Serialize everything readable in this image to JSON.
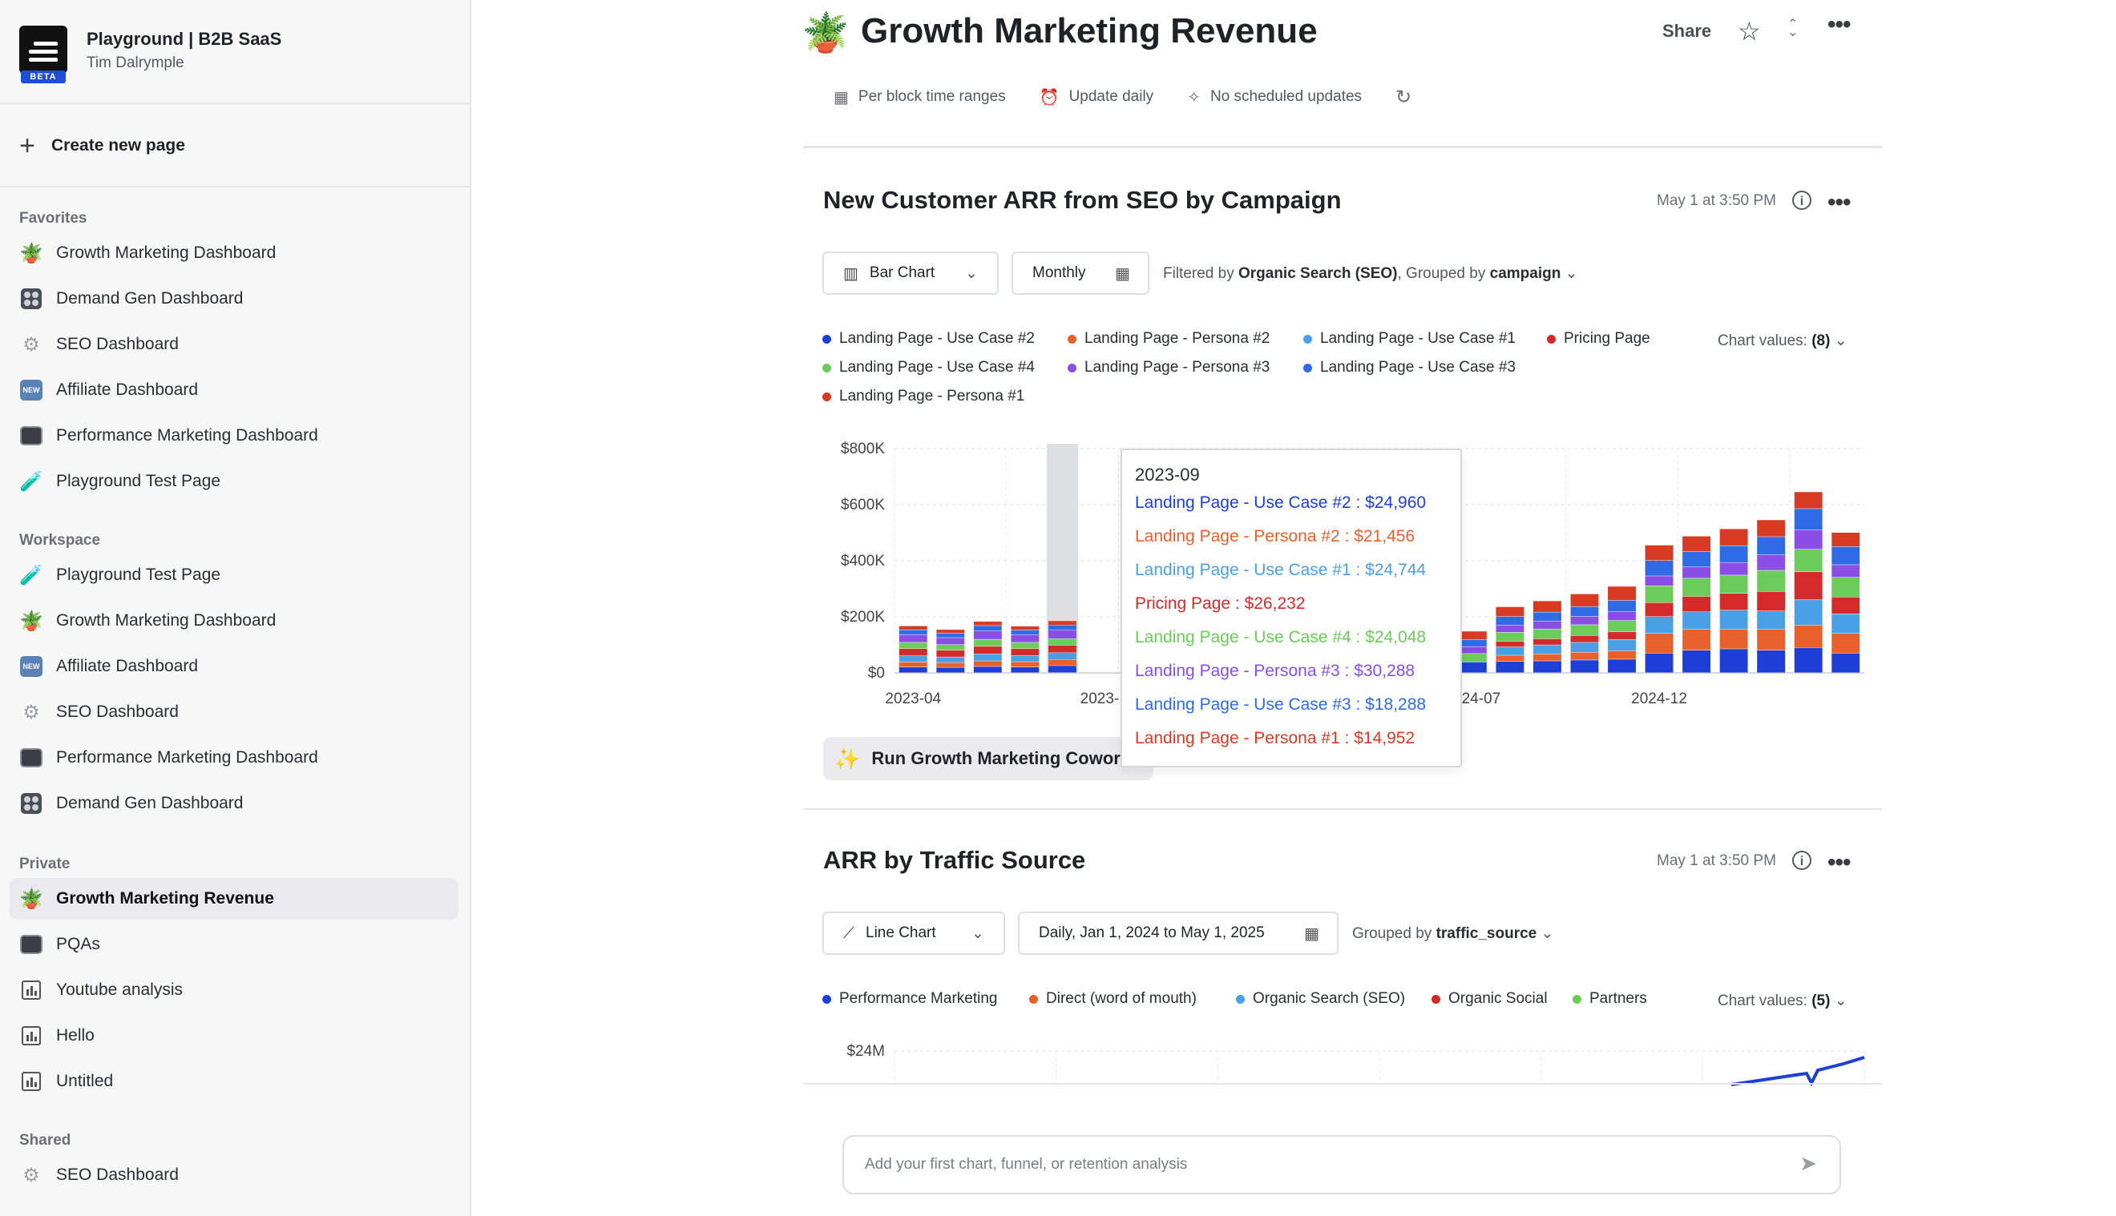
{
  "workspace": {
    "org_name": "Playground | B2B SaaS",
    "user_name": "Tim Dalrymple",
    "logo_badge": "BETA"
  },
  "sidebar": {
    "create_label": "Create new page",
    "sections": [
      {
        "title": "Favorites",
        "items": [
          {
            "label": "Growth Marketing Dashboard",
            "icon": "plant-icon"
          },
          {
            "label": "Demand Gen Dashboard",
            "icon": "grid-icon"
          },
          {
            "label": "SEO Dashboard",
            "icon": "gear-icon"
          },
          {
            "label": "Affiliate Dashboard",
            "icon": "new-badge-icon"
          },
          {
            "label": "Performance Marketing Dashboard",
            "icon": "monitor-icon"
          },
          {
            "label": "Playground Test Page",
            "icon": "test-tube-icon"
          }
        ]
      },
      {
        "title": "Workspace",
        "items": [
          {
            "label": "Playground Test Page",
            "icon": "test-tube-icon"
          },
          {
            "label": "Growth Marketing Dashboard",
            "icon": "plant-icon"
          },
          {
            "label": "Affiliate Dashboard",
            "icon": "new-badge-icon"
          },
          {
            "label": "SEO Dashboard",
            "icon": "gear-icon"
          },
          {
            "label": "Performance Marketing Dashboard",
            "icon": "monitor-icon"
          },
          {
            "label": "Demand Gen Dashboard",
            "icon": "grid-icon"
          }
        ]
      },
      {
        "title": "Private",
        "items": [
          {
            "label": "Growth Marketing Revenue",
            "icon": "plant-icon",
            "active": true
          },
          {
            "label": "PQAs",
            "icon": "monitor-icon"
          },
          {
            "label": "Youtube analysis",
            "icon": "chart-icon"
          },
          {
            "label": "Hello",
            "icon": "chart-icon"
          },
          {
            "label": "Untitled",
            "icon": "chart-icon"
          }
        ]
      },
      {
        "title": "Shared",
        "items": [
          {
            "label": "SEO Dashboard",
            "icon": "gear-icon"
          }
        ]
      }
    ]
  },
  "header": {
    "title": "Growth Marketing Revenue",
    "share_label": "Share",
    "meta": [
      "Per block time ranges",
      "Update daily",
      "No scheduled updates"
    ]
  },
  "card1": {
    "title": "New Customer ARR from SEO by Campaign",
    "timestamp": "May 1 at 3:50 PM",
    "chart_type_label": "Bar Chart",
    "interval_label": "Monthly",
    "filter_prefix": "Filtered by",
    "filter_value": "Organic Search (SEO)",
    "group_prefix": ", Grouped by",
    "group_value": "campaign",
    "chart_values_label": "Chart values:",
    "chart_values_count": "(8)",
    "run_label": "Run Growth Marketing Cowork",
    "tooltip": {
      "header": "2023-09",
      "rows": [
        {
          "text": "Landing Page - Use Case #2 : $24,960",
          "color": "#1d3fd8"
        },
        {
          "text": "Landing Page - Persona #2 : $21,456",
          "color": "#e8612c"
        },
        {
          "text": "Landing Page - Use Case #1 : $24,744",
          "color": "#4aa0e6"
        },
        {
          "text": "Pricing Page : $26,232",
          "color": "#d42a2a"
        },
        {
          "text": "Landing Page - Use Case #4 : $24,048",
          "color": "#6ccc5a"
        },
        {
          "text": "Landing Page - Persona #3 : $30,288",
          "color": "#8a4de6"
        },
        {
          "text": "Landing Page - Use Case #3 : $18,288",
          "color": "#2f6be6"
        },
        {
          "text": "Landing Page - Persona #1 : $14,952",
          "color": "#d83a22"
        }
      ]
    }
  },
  "card2": {
    "title": "ARR by Traffic Source",
    "timestamp": "May 1 at 3:50 PM",
    "chart_type_label": "Line Chart",
    "date_range_label": "Daily, Jan 1, 2024 to May 1, 2025",
    "group_prefix": "Grouped by",
    "group_value": "traffic_source",
    "chart_values_label": "Chart values:",
    "chart_values_count": "(5)"
  },
  "composer": {
    "placeholder": "Add your first chart, funnel, or retention analysis"
  },
  "chart_data": [
    {
      "type": "bar",
      "stacked": true,
      "title": "New Customer ARR from SEO by Campaign",
      "ylim": [
        0,
        800000
      ],
      "y_ticks": [
        "$0",
        "$200K",
        "$400K",
        "$600K",
        "$800K"
      ],
      "x_tick_labels": [
        {
          "label": "2023-04",
          "index": 0
        },
        {
          "label": "2023-",
          "index": 5
        },
        {
          "label": "2024-07",
          "index": 15
        },
        {
          "label": "2024-12",
          "index": 20
        }
      ],
      "hover_index": 4,
      "legend_position": "top",
      "series": [
        {
          "name": "Landing Page - Use Case #2",
          "color": "#1d3fd8",
          "values": [
            20000,
            19000,
            22000,
            20000,
            24960,
            0,
            0,
            0,
            0,
            0,
            0,
            0,
            0,
            0,
            0,
            38000,
            40000,
            42000,
            45000,
            48000,
            70000,
            80000,
            85000,
            80000,
            90000,
            70000
          ]
        },
        {
          "name": "Landing Page - Persona #2",
          "color": "#e8612c",
          "values": [
            18000,
            17000,
            20000,
            19000,
            21456,
            0,
            0,
            0,
            0,
            0,
            0,
            0,
            0,
            0,
            0,
            0,
            22000,
            25000,
            28000,
            30000,
            70000,
            75000,
            70000,
            75000,
            80000,
            70000
          ]
        },
        {
          "name": "Landing Page - Use Case #1",
          "color": "#4aa0e6",
          "values": [
            22000,
            20000,
            25000,
            22000,
            24744,
            0,
            0,
            0,
            0,
            0,
            0,
            0,
            0,
            0,
            0,
            0,
            30000,
            32000,
            35000,
            40000,
            60000,
            62000,
            68000,
            65000,
            90000,
            70000
          ]
        },
        {
          "name": "Pricing Page",
          "color": "#d42a2a",
          "values": [
            26000,
            24000,
            27000,
            25000,
            26232,
            0,
            0,
            0,
            0,
            0,
            0,
            0,
            0,
            0,
            0,
            0,
            20000,
            22000,
            25000,
            28000,
            50000,
            55000,
            60000,
            70000,
            100000,
            60000
          ]
        },
        {
          "name": "Landing Page - Use Case #4",
          "color": "#6ccc5a",
          "values": [
            22000,
            20000,
            25000,
            22000,
            24048,
            0,
            0,
            0,
            0,
            0,
            0,
            0,
            0,
            0,
            0,
            30000,
            32000,
            35000,
            38000,
            40000,
            60000,
            65000,
            65000,
            75000,
            80000,
            70000
          ]
        },
        {
          "name": "Landing Page - Persona #3",
          "color": "#8a4de6",
          "values": [
            28000,
            25000,
            30000,
            27000,
            30288,
            0,
            0,
            0,
            0,
            0,
            0,
            0,
            0,
            0,
            0,
            25000,
            26000,
            28000,
            30000,
            32000,
            35000,
            40000,
            45000,
            55000,
            70000,
            45000
          ]
        },
        {
          "name": "Landing Page - Use Case #3",
          "color": "#2f6be6",
          "values": [
            17000,
            16000,
            19000,
            17000,
            18288,
            0,
            0,
            0,
            0,
            0,
            0,
            0,
            0,
            0,
            0,
            25000,
            30000,
            32000,
            35000,
            40000,
            55000,
            55000,
            60000,
            65000,
            75000,
            65000
          ]
        },
        {
          "name": "Landing Page - Persona #1",
          "color": "#d83a22",
          "values": [
            14000,
            13000,
            15000,
            14000,
            14952,
            0,
            0,
            0,
            0,
            0,
            0,
            0,
            0,
            0,
            0,
            30000,
            35000,
            40000,
            45000,
            50000,
            55000,
            55000,
            60000,
            60000,
            60000,
            50000
          ]
        }
      ]
    },
    {
      "type": "line",
      "title": "ARR by Traffic Source",
      "y_ticks": [
        "$24M"
      ],
      "legend_position": "top",
      "series": [
        {
          "name": "Performance Marketing",
          "color": "#1d3fd8"
        },
        {
          "name": "Direct (word of mouth)",
          "color": "#e8612c"
        },
        {
          "name": "Organic Search (SEO)",
          "color": "#4aa0e6"
        },
        {
          "name": "Organic Social",
          "color": "#d42a2a"
        },
        {
          "name": "Partners",
          "color": "#6ccc5a"
        }
      ]
    }
  ]
}
